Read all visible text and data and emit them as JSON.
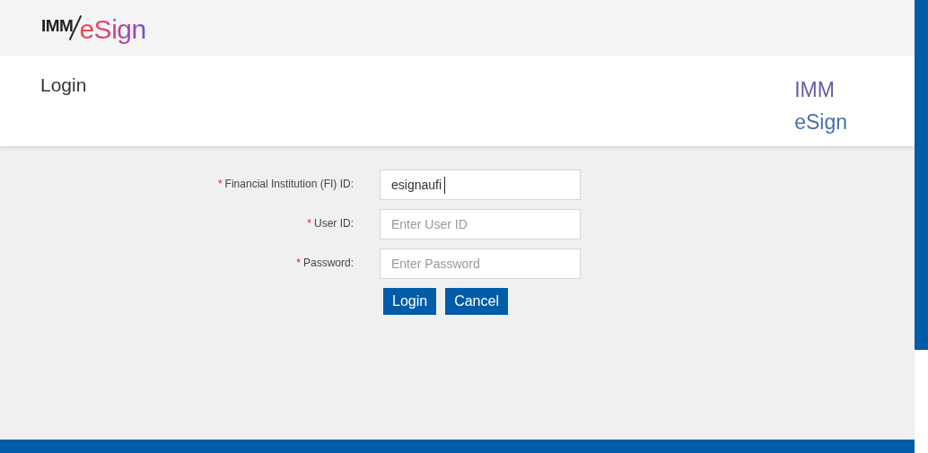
{
  "logo": {
    "left": "IMM",
    "right": "eSign"
  },
  "title_card": {
    "title": "Login",
    "brand_lines": [
      "IMM",
      "eSign"
    ]
  },
  "form": {
    "fields": [
      {
        "label": "Financial Institution (FI) ID:",
        "required": true,
        "value": "esignaufi",
        "focused": true
      },
      {
        "label": "User ID:",
        "required": true,
        "placeholder": "Enter User ID",
        "focused": false
      },
      {
        "label": "Password:",
        "required": true,
        "placeholder": "Enter Password",
        "focused": false
      }
    ],
    "required_mark": "*",
    "buttons": [
      "Login",
      "Cancel"
    ]
  }
}
